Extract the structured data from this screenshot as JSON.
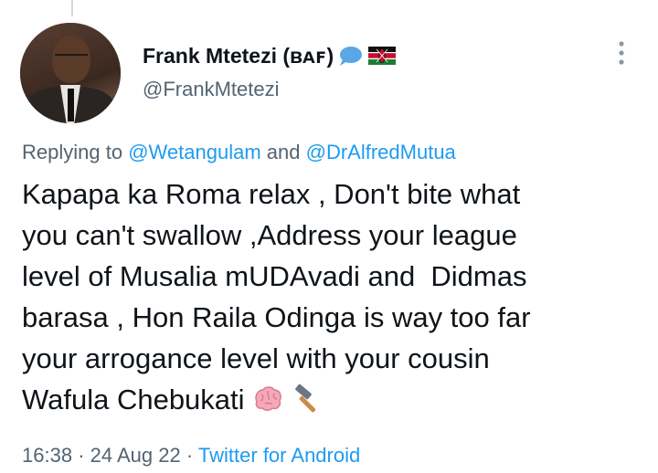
{
  "tweet": {
    "author_name": "Frank Mtetezi (ʙᴀꜰ)",
    "author_handle": "@FrankMtetezi",
    "replying_prefix": "Replying to",
    "reply_mention_1": "@Wetangulam",
    "reply_connector": "and",
    "reply_mention_2": "@DrAlfredMutua",
    "text_lines": [
      "Kapapa ka Roma relax , Don't bite what",
      "you can't swallow ,Address your league",
      "level of Musalia mUDAvadi and  Didmas",
      "barasa , Hon Raila Odinga is way too far",
      "your arrogance level with your cousin",
      "Wafula Chebukati"
    ],
    "emojis": [
      "brain-emoji",
      "hammer-emoji"
    ],
    "time": "16:38",
    "separator": "·",
    "date": "24 Aug 22",
    "source": "Twitter for Android"
  },
  "icons": {
    "name_icons": [
      "speech-bubble-icon",
      "kenya-flag-icon"
    ],
    "more": "more-options-icon"
  },
  "colors": {
    "link": "#1d9bf0",
    "secondary_text": "#536471",
    "primary_text": "#0f1419"
  }
}
